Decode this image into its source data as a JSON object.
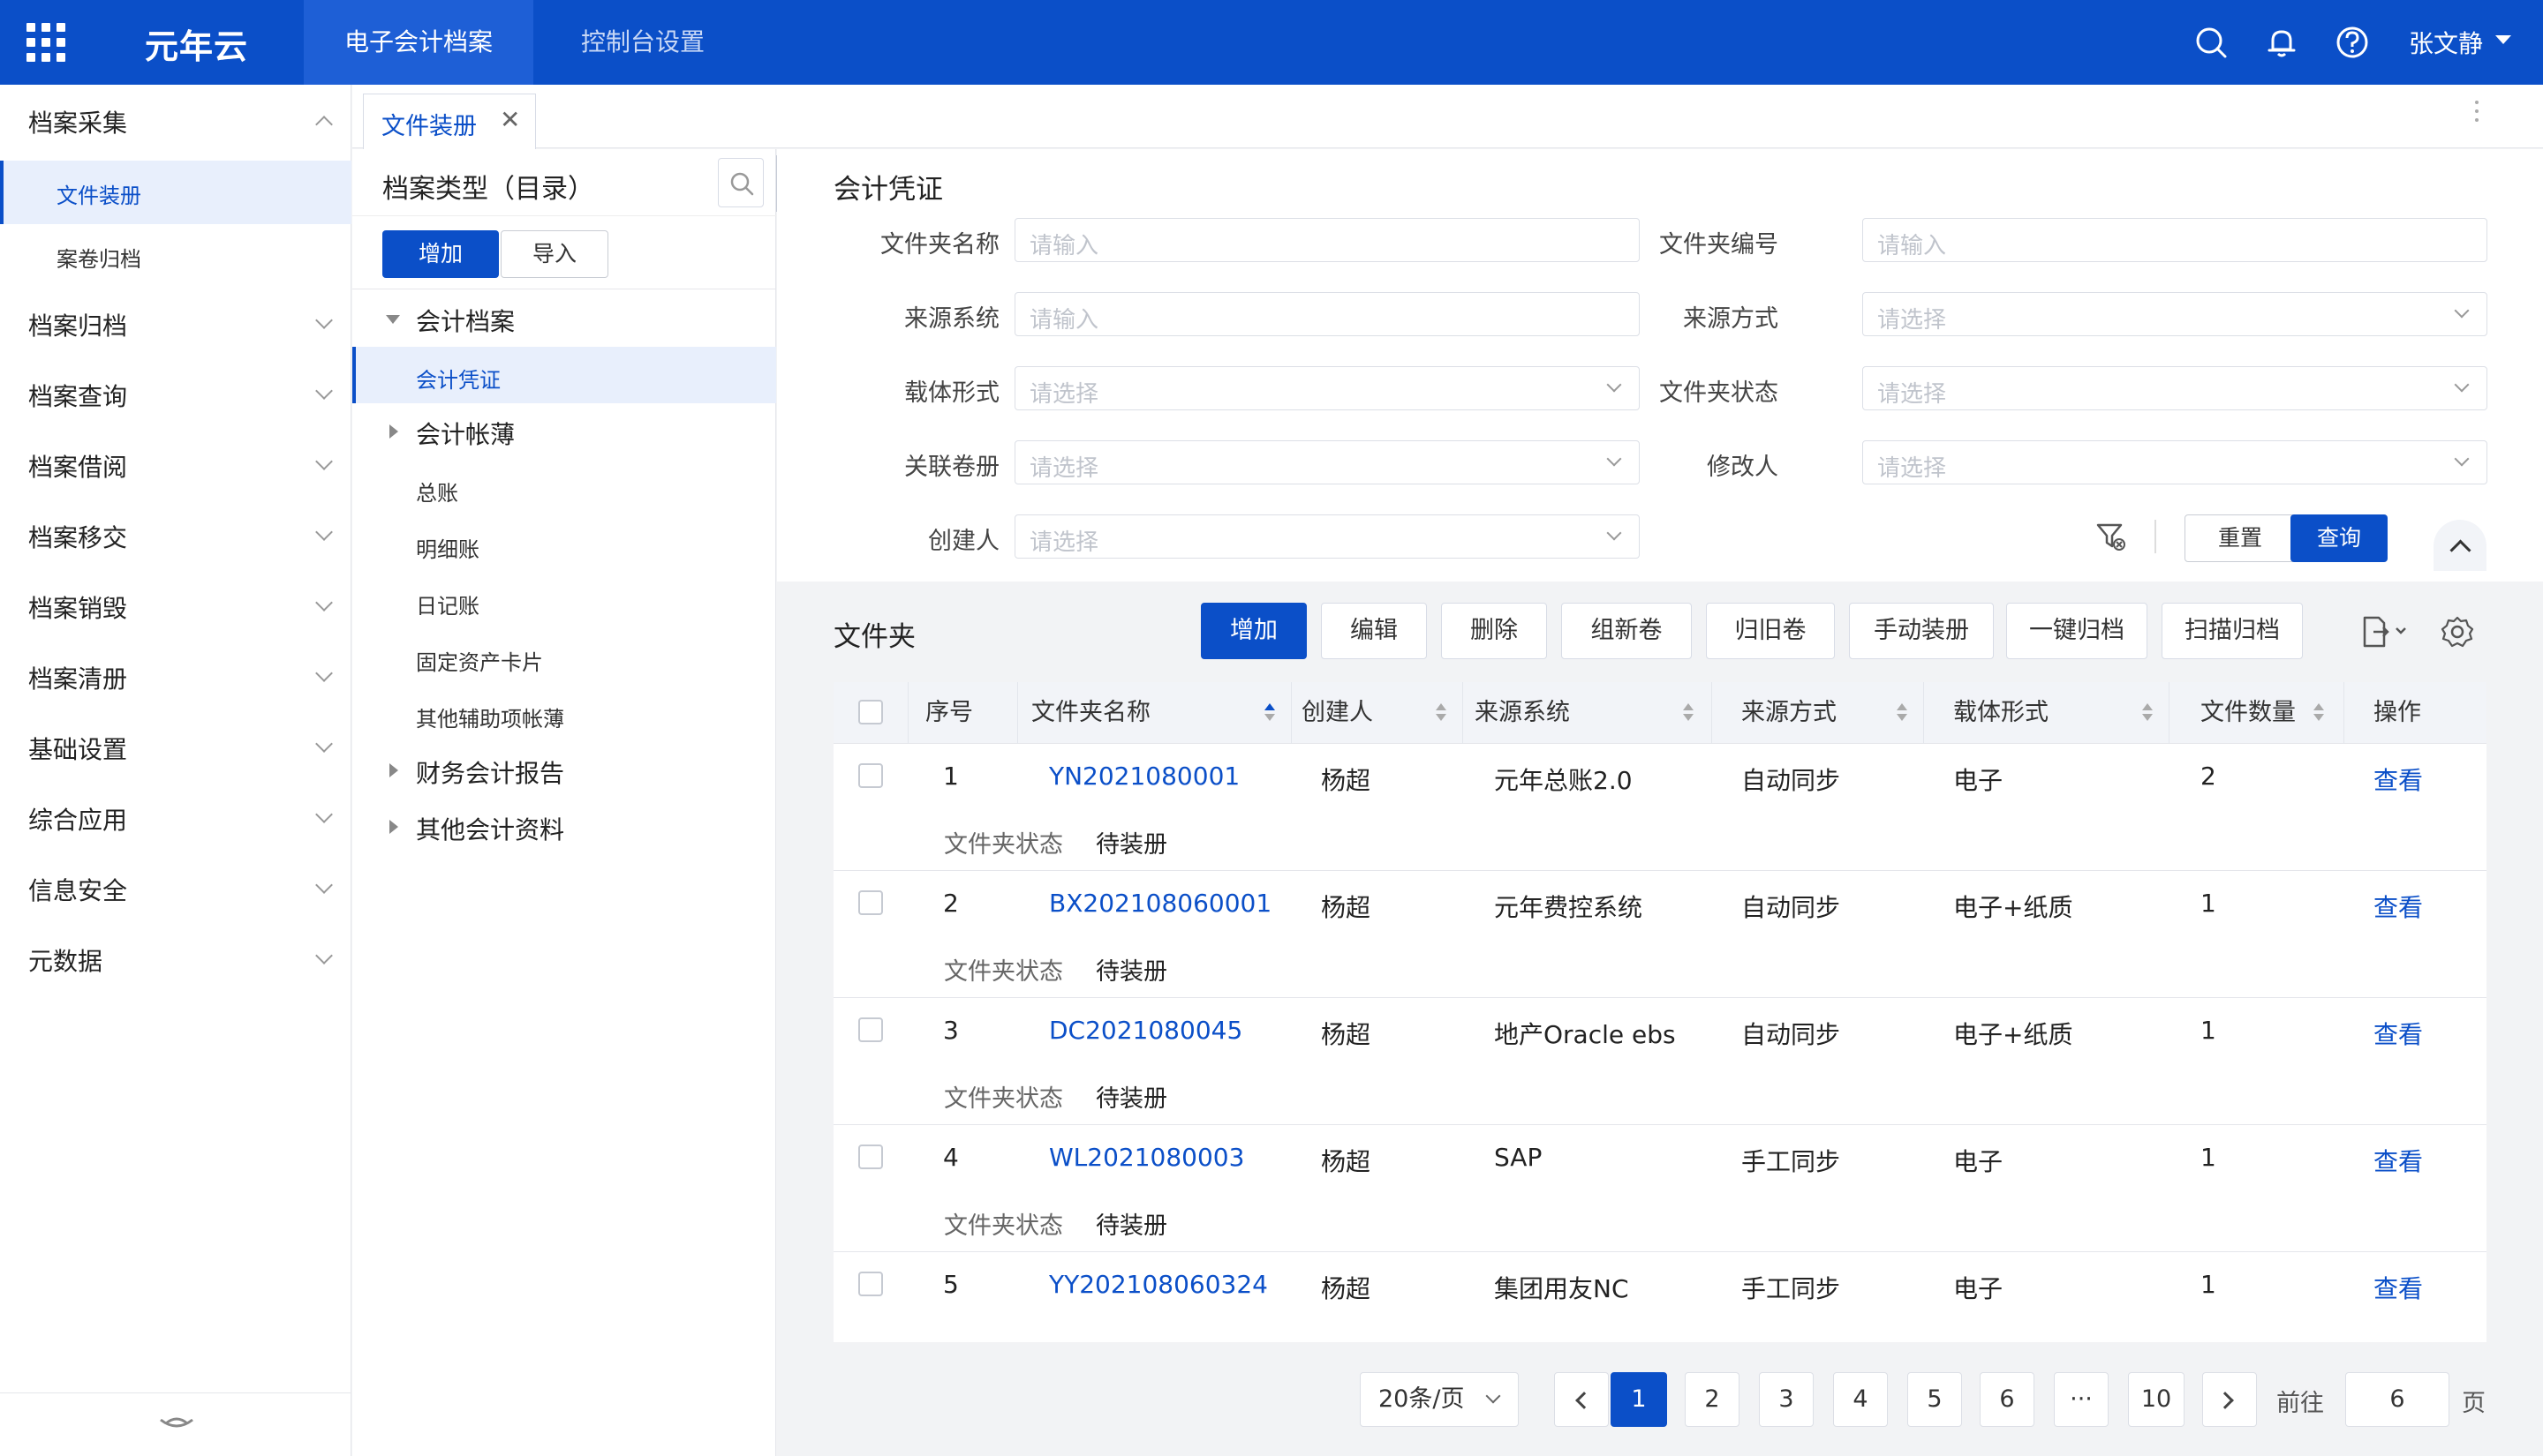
{
  "header": {
    "logo": "元年云",
    "nav": [
      {
        "label": "电子会计档案",
        "active": true
      },
      {
        "label": "控制台设置",
        "active": false
      }
    ],
    "user": "张文静",
    "icons": [
      "search-icon",
      "bell-icon",
      "help-icon"
    ]
  },
  "sidebar": {
    "groups": [
      {
        "label": "档案采集",
        "expanded": true,
        "children": [
          {
            "label": "文件装册",
            "active": true
          },
          {
            "label": "案卷归档",
            "active": false
          }
        ]
      },
      {
        "label": "档案归档"
      },
      {
        "label": "档案查询"
      },
      {
        "label": "档案借阅"
      },
      {
        "label": "档案移交"
      },
      {
        "label": "档案销毁"
      },
      {
        "label": "档案清册"
      },
      {
        "label": "基础设置"
      },
      {
        "label": "综合应用"
      },
      {
        "label": "信息安全"
      },
      {
        "label": "元数据"
      }
    ]
  },
  "tabs": [
    {
      "label": "文件装册",
      "close": "✕"
    }
  ],
  "tree": {
    "title": "档案类型（目录）",
    "add_label": "增加",
    "import_label": "导入",
    "nodes": [
      {
        "label": "会计档案",
        "level": 1,
        "arrow": "down"
      },
      {
        "label": "会计凭证",
        "level": 2,
        "active": true
      },
      {
        "label": "会计帐薄",
        "level": 1,
        "arrow": "right"
      },
      {
        "label": "总账",
        "level": 2
      },
      {
        "label": "明细账",
        "level": 2
      },
      {
        "label": "日记账",
        "level": 2
      },
      {
        "label": "固定资产卡片",
        "level": 2
      },
      {
        "label": "其他辅助项帐薄",
        "level": 2
      },
      {
        "label": "财务会计报告",
        "level": 1,
        "arrow": "right"
      },
      {
        "label": "其他会计资料",
        "level": 1,
        "arrow": "right"
      }
    ]
  },
  "filter": {
    "title": "会计凭证",
    "fields": [
      {
        "label": "文件夹名称",
        "placeholder": "请输入",
        "type": "input"
      },
      {
        "label": "文件夹编号",
        "placeholder": "请输入",
        "type": "input"
      },
      {
        "label": "来源系统",
        "placeholder": "请输入",
        "type": "input"
      },
      {
        "label": "来源方式",
        "placeholder": "请选择",
        "type": "select"
      },
      {
        "label": "载体形式",
        "placeholder": "请选择",
        "type": "select"
      },
      {
        "label": "文件夹状态",
        "placeholder": "请选择",
        "type": "select"
      },
      {
        "label": "关联卷册",
        "placeholder": "请选择",
        "type": "select"
      },
      {
        "label": "修改人",
        "placeholder": "请选择",
        "type": "select"
      },
      {
        "label": "创建人",
        "placeholder": "请选择",
        "type": "select"
      }
    ],
    "reset_label": "重置",
    "query_label": "查询"
  },
  "folder": {
    "title": "文件夹",
    "toolbar": [
      "增加",
      "编辑",
      "删除",
      "组新卷",
      "归旧卷",
      "手动装册",
      "一键归档",
      "扫描归档"
    ],
    "columns": [
      "序号",
      "文件夹名称",
      "创建人",
      "来源系统",
      "来源方式",
      "载体形式",
      "文件数量",
      "操作"
    ],
    "status_label": "文件夹状态",
    "rows": [
      {
        "no": "1",
        "name": "YN2021080001",
        "creator": "杨超",
        "system": "元年总账2.0",
        "method": "自动同步",
        "carrier": "电子",
        "count": "2",
        "action": "查看",
        "status": "待装册"
      },
      {
        "no": "2",
        "name": "BX202108060001",
        "creator": "杨超",
        "system": "元年费控系统",
        "method": "自动同步",
        "carrier": "电子+纸质",
        "count": "1",
        "action": "查看",
        "status": "待装册"
      },
      {
        "no": "3",
        "name": "DC2021080045",
        "creator": "杨超",
        "system": "地产Oracle ebs",
        "method": "自动同步",
        "carrier": "电子+纸质",
        "count": "1",
        "action": "查看",
        "status": "待装册"
      },
      {
        "no": "4",
        "name": "WL2021080003",
        "creator": "杨超",
        "system": "SAP",
        "method": "手工同步",
        "carrier": "电子",
        "count": "1",
        "action": "查看",
        "status": "待装册"
      },
      {
        "no": "5",
        "name": "YY202108060324",
        "creator": "杨超",
        "system": "集团用友NC",
        "method": "手工同步",
        "carrier": "电子",
        "count": "1",
        "action": "查看",
        "status": ""
      }
    ]
  },
  "pagination": {
    "page_size": "20条/页",
    "pages": [
      "1",
      "2",
      "3",
      "4",
      "5",
      "6",
      "···",
      "10"
    ],
    "current": "1",
    "goto_label": "前往",
    "goto_value": "6",
    "page_suffix": "页"
  },
  "colors": {
    "primary": "#0b4fc8",
    "header_bg": "#0b4fc8",
    "active_bg": "#e8effc"
  }
}
